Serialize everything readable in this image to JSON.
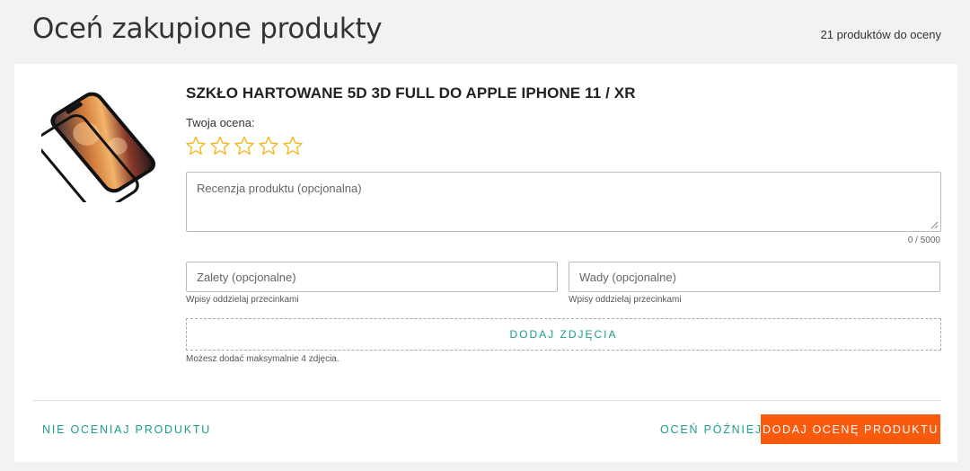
{
  "header": {
    "title": "Oceń zakupione produkty",
    "count": "21 produktów do oceny"
  },
  "product": {
    "name": "SZKŁO HARTOWANE 5D 3D FULL DO APPLE IPHONE 11 / XR",
    "image_icon": "phone-screen-protector-image"
  },
  "rating": {
    "label": "Twoja ocena:",
    "max_stars": 5,
    "value": 0,
    "star_color": "#f2b91e"
  },
  "review": {
    "placeholder": "Recenzja produktu (opcjonalna)",
    "value": "",
    "counter": "0 / 5000"
  },
  "pros": {
    "placeholder": "Zalety (opcjonalne)",
    "value": "",
    "hint": "Wpisy oddzielaj przecinkami"
  },
  "cons": {
    "placeholder": "Wady (opcjonalne)",
    "value": "",
    "hint": "Wpisy oddzielaj przecinkami"
  },
  "photos": {
    "button_label": "DODAJ ZDJĘCIA",
    "note": "Możesz dodać maksymalnie 4 zdjęcia."
  },
  "actions": {
    "skip_label": "NIE OCENIAJ PRODUKTU",
    "later_label": "OCEŃ PÓŹNIEJ",
    "submit_label": "DODAJ OCENĘ PRODUKTU"
  },
  "colors": {
    "accent": "#1a9e8c",
    "primary_button": "#fa5a0e"
  }
}
